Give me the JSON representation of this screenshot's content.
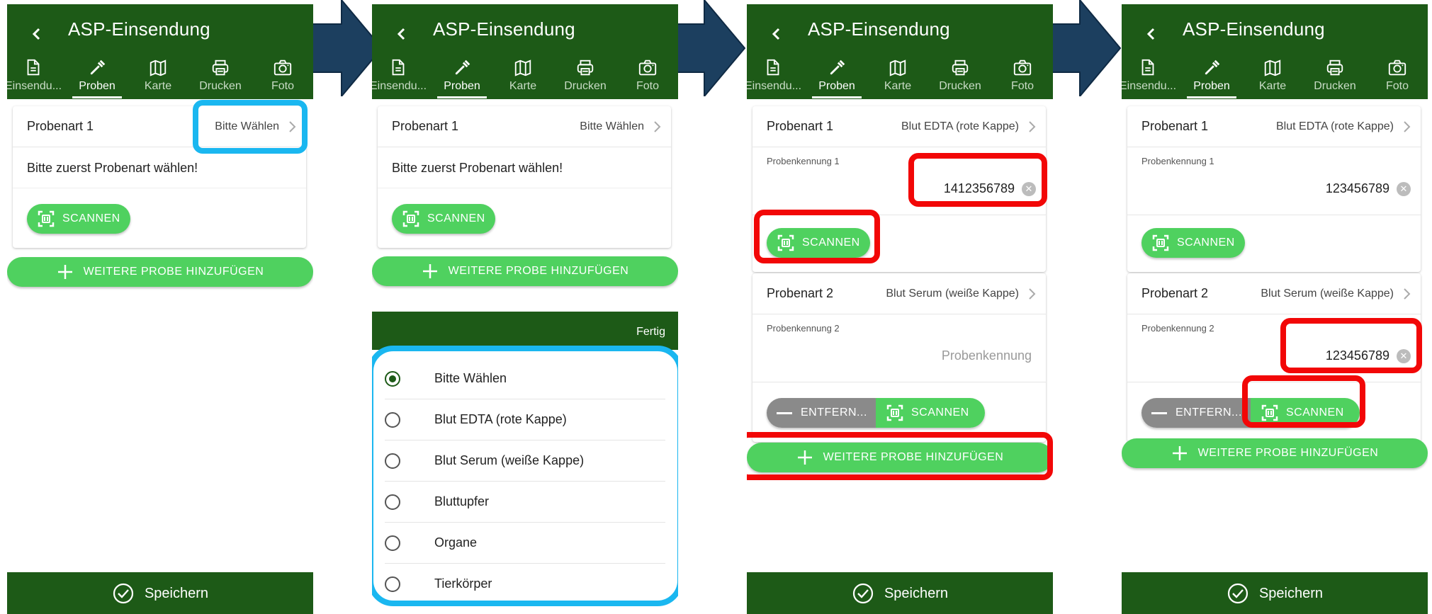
{
  "app": {
    "title": "ASP-Einsendung",
    "tabs": [
      "Einsendu...",
      "Proben",
      "Karte",
      "Drucken",
      "Foto"
    ],
    "active_tab": "Proben"
  },
  "colors": {
    "appbar": "#1d5a17",
    "button_green": "#4fd15f",
    "remove_grey": "#8a8a8a",
    "highlight_blue": "#1ab7f0",
    "highlight_red": "#f20707",
    "arrow": "#1c3f5f"
  },
  "icons": {
    "back": "chevron-left-icon",
    "tab_icons": [
      "document-icon",
      "pipette-icon",
      "map-icon",
      "printer-icon",
      "camera-icon"
    ],
    "scan": "qr-scan-icon",
    "add": "plus-icon",
    "remove": "minus-icon",
    "save": "check-circle-icon",
    "clear": "clear-icon",
    "chevron": "chevron-right-icon"
  },
  "labels": {
    "scan": "SCANNEN",
    "add": "WEITERE PROBE HINZUFÜGEN",
    "remove": "ENTFERN...",
    "save": "Speichern",
    "done": "Fertig",
    "clear_glyph": "✕"
  },
  "screen1": {
    "p1_label": "Probenart 1",
    "p1_value": "Bitte Wählen",
    "hint": "Bitte zuerst Probenart wählen!"
  },
  "screen2": {
    "p1_label": "Probenart 1",
    "p1_value": "Bitte Wählen",
    "hint": "Bitte zuerst Probenart wählen!",
    "options": [
      "Bitte Wählen",
      "Blut EDTA (rote Kappe)",
      "Blut Serum (weiße Kappe)",
      "Bluttupfer",
      "Organe",
      "Tierkörper"
    ],
    "selected_option": "Bitte Wählen"
  },
  "screen3": {
    "p1_label": "Probenart 1",
    "p1_value": "Blut EDTA (rote Kappe)",
    "id1_label": "Probenkennung 1",
    "id1_value": "1412356789",
    "p2_label": "Probenart 2",
    "p2_value": "Blut Serum (weiße Kappe)",
    "id2_label": "Probenkennung 2",
    "id2_placeholder": "Probenkennung"
  },
  "screen4": {
    "p1_label": "Probenart 1",
    "p1_value": "Blut EDTA (rote Kappe)",
    "id1_label": "Probenkennung 1",
    "id1_value": "123456789",
    "p2_label": "Probenart 2",
    "p2_value": "Blut Serum (weiße Kappe)",
    "id2_label": "Probenkennung 2",
    "id2_value": "123456789"
  }
}
